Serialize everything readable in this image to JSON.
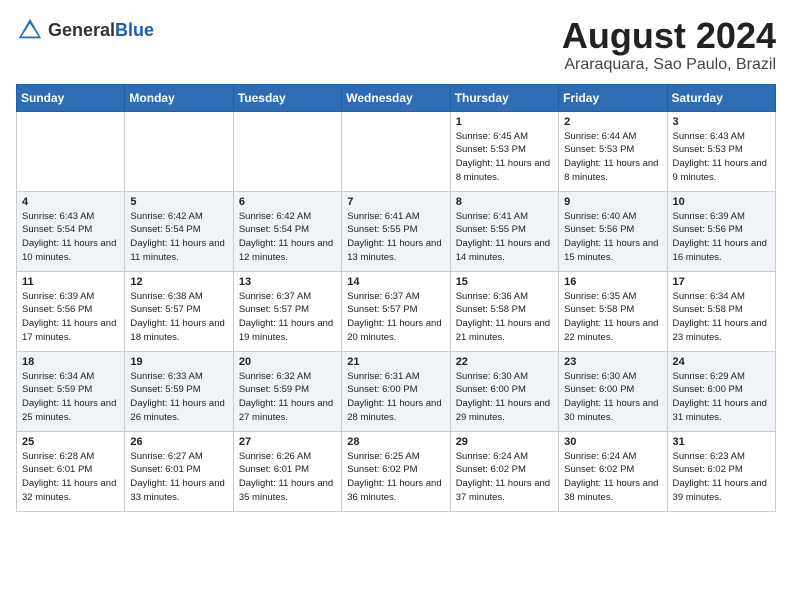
{
  "header": {
    "logo_general": "General",
    "logo_blue": "Blue",
    "month": "August 2024",
    "location": "Araraquara, Sao Paulo, Brazil"
  },
  "weekdays": [
    "Sunday",
    "Monday",
    "Tuesday",
    "Wednesday",
    "Thursday",
    "Friday",
    "Saturday"
  ],
  "weeks": [
    [
      {
        "day": "",
        "sunrise": "",
        "sunset": "",
        "daylight": ""
      },
      {
        "day": "",
        "sunrise": "",
        "sunset": "",
        "daylight": ""
      },
      {
        "day": "",
        "sunrise": "",
        "sunset": "",
        "daylight": ""
      },
      {
        "day": "",
        "sunrise": "",
        "sunset": "",
        "daylight": ""
      },
      {
        "day": "1",
        "sunrise": "Sunrise: 6:45 AM",
        "sunset": "Sunset: 5:53 PM",
        "daylight": "Daylight: 11 hours and 8 minutes."
      },
      {
        "day": "2",
        "sunrise": "Sunrise: 6:44 AM",
        "sunset": "Sunset: 5:53 PM",
        "daylight": "Daylight: 11 hours and 8 minutes."
      },
      {
        "day": "3",
        "sunrise": "Sunrise: 6:43 AM",
        "sunset": "Sunset: 5:53 PM",
        "daylight": "Daylight: 11 hours and 9 minutes."
      }
    ],
    [
      {
        "day": "4",
        "sunrise": "Sunrise: 6:43 AM",
        "sunset": "Sunset: 5:54 PM",
        "daylight": "Daylight: 11 hours and 10 minutes."
      },
      {
        "day": "5",
        "sunrise": "Sunrise: 6:42 AM",
        "sunset": "Sunset: 5:54 PM",
        "daylight": "Daylight: 11 hours and 11 minutes."
      },
      {
        "day": "6",
        "sunrise": "Sunrise: 6:42 AM",
        "sunset": "Sunset: 5:54 PM",
        "daylight": "Daylight: 11 hours and 12 minutes."
      },
      {
        "day": "7",
        "sunrise": "Sunrise: 6:41 AM",
        "sunset": "Sunset: 5:55 PM",
        "daylight": "Daylight: 11 hours and 13 minutes."
      },
      {
        "day": "8",
        "sunrise": "Sunrise: 6:41 AM",
        "sunset": "Sunset: 5:55 PM",
        "daylight": "Daylight: 11 hours and 14 minutes."
      },
      {
        "day": "9",
        "sunrise": "Sunrise: 6:40 AM",
        "sunset": "Sunset: 5:56 PM",
        "daylight": "Daylight: 11 hours and 15 minutes."
      },
      {
        "day": "10",
        "sunrise": "Sunrise: 6:39 AM",
        "sunset": "Sunset: 5:56 PM",
        "daylight": "Daylight: 11 hours and 16 minutes."
      }
    ],
    [
      {
        "day": "11",
        "sunrise": "Sunrise: 6:39 AM",
        "sunset": "Sunset: 5:56 PM",
        "daylight": "Daylight: 11 hours and 17 minutes."
      },
      {
        "day": "12",
        "sunrise": "Sunrise: 6:38 AM",
        "sunset": "Sunset: 5:57 PM",
        "daylight": "Daylight: 11 hours and 18 minutes."
      },
      {
        "day": "13",
        "sunrise": "Sunrise: 6:37 AM",
        "sunset": "Sunset: 5:57 PM",
        "daylight": "Daylight: 11 hours and 19 minutes."
      },
      {
        "day": "14",
        "sunrise": "Sunrise: 6:37 AM",
        "sunset": "Sunset: 5:57 PM",
        "daylight": "Daylight: 11 hours and 20 minutes."
      },
      {
        "day": "15",
        "sunrise": "Sunrise: 6:36 AM",
        "sunset": "Sunset: 5:58 PM",
        "daylight": "Daylight: 11 hours and 21 minutes."
      },
      {
        "day": "16",
        "sunrise": "Sunrise: 6:35 AM",
        "sunset": "Sunset: 5:58 PM",
        "daylight": "Daylight: 11 hours and 22 minutes."
      },
      {
        "day": "17",
        "sunrise": "Sunrise: 6:34 AM",
        "sunset": "Sunset: 5:58 PM",
        "daylight": "Daylight: 11 hours and 23 minutes."
      }
    ],
    [
      {
        "day": "18",
        "sunrise": "Sunrise: 6:34 AM",
        "sunset": "Sunset: 5:59 PM",
        "daylight": "Daylight: 11 hours and 25 minutes."
      },
      {
        "day": "19",
        "sunrise": "Sunrise: 6:33 AM",
        "sunset": "Sunset: 5:59 PM",
        "daylight": "Daylight: 11 hours and 26 minutes."
      },
      {
        "day": "20",
        "sunrise": "Sunrise: 6:32 AM",
        "sunset": "Sunset: 5:59 PM",
        "daylight": "Daylight: 11 hours and 27 minutes."
      },
      {
        "day": "21",
        "sunrise": "Sunrise: 6:31 AM",
        "sunset": "Sunset: 6:00 PM",
        "daylight": "Daylight: 11 hours and 28 minutes."
      },
      {
        "day": "22",
        "sunrise": "Sunrise: 6:30 AM",
        "sunset": "Sunset: 6:00 PM",
        "daylight": "Daylight: 11 hours and 29 minutes."
      },
      {
        "day": "23",
        "sunrise": "Sunrise: 6:30 AM",
        "sunset": "Sunset: 6:00 PM",
        "daylight": "Daylight: 11 hours and 30 minutes."
      },
      {
        "day": "24",
        "sunrise": "Sunrise: 6:29 AM",
        "sunset": "Sunset: 6:00 PM",
        "daylight": "Daylight: 11 hours and 31 minutes."
      }
    ],
    [
      {
        "day": "25",
        "sunrise": "Sunrise: 6:28 AM",
        "sunset": "Sunset: 6:01 PM",
        "daylight": "Daylight: 11 hours and 32 minutes."
      },
      {
        "day": "26",
        "sunrise": "Sunrise: 6:27 AM",
        "sunset": "Sunset: 6:01 PM",
        "daylight": "Daylight: 11 hours and 33 minutes."
      },
      {
        "day": "27",
        "sunrise": "Sunrise: 6:26 AM",
        "sunset": "Sunset: 6:01 PM",
        "daylight": "Daylight: 11 hours and 35 minutes."
      },
      {
        "day": "28",
        "sunrise": "Sunrise: 6:25 AM",
        "sunset": "Sunset: 6:02 PM",
        "daylight": "Daylight: 11 hours and 36 minutes."
      },
      {
        "day": "29",
        "sunrise": "Sunrise: 6:24 AM",
        "sunset": "Sunset: 6:02 PM",
        "daylight": "Daylight: 11 hours and 37 minutes."
      },
      {
        "day": "30",
        "sunrise": "Sunrise: 6:24 AM",
        "sunset": "Sunset: 6:02 PM",
        "daylight": "Daylight: 11 hours and 38 minutes."
      },
      {
        "day": "31",
        "sunrise": "Sunrise: 6:23 AM",
        "sunset": "Sunset: 6:02 PM",
        "daylight": "Daylight: 11 hours and 39 minutes."
      }
    ]
  ]
}
